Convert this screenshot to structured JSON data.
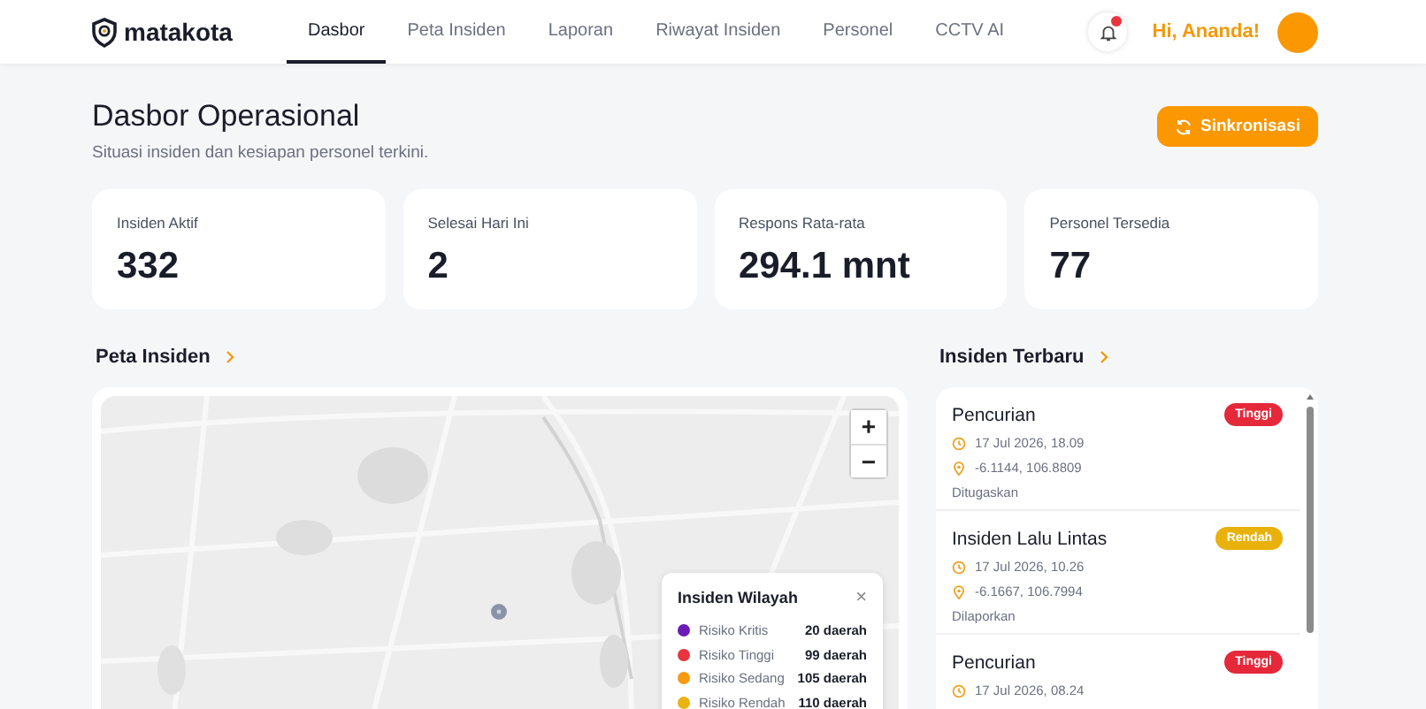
{
  "header": {
    "brand": "matakota",
    "nav": [
      {
        "label": "Dasbor",
        "selected": true
      },
      {
        "label": "Peta Insiden",
        "selected": false
      },
      {
        "label": "Laporan",
        "selected": false
      },
      {
        "label": "Riwayat Insiden",
        "selected": false
      },
      {
        "label": "Personel",
        "selected": false
      },
      {
        "label": "CCTV AI",
        "selected": false
      }
    ],
    "notification_unread": true,
    "greeting": "Hi, Ananda!"
  },
  "page": {
    "title": "Dasbor Operasional",
    "subtitle": "Situasi insiden dan kesiapan personel terkini.",
    "sync_button": "Sinkronisasi"
  },
  "stats": [
    {
      "label": "Insiden Aktif",
      "value": "332"
    },
    {
      "label": "Selesai Hari Ini",
      "value": "2"
    },
    {
      "label": "Respons Rata-rata",
      "value": "294.1 mnt"
    },
    {
      "label": "Personel Tersedia",
      "value": "77"
    }
  ],
  "map_section": {
    "title": "Peta Insiden",
    "zoom_in": "+",
    "zoom_out": "−",
    "legend": {
      "title": "Insiden Wilayah",
      "close": "×",
      "items": [
        {
          "label": "Risiko Kritis",
          "count": "20 daerah",
          "color": "#6a1bb5"
        },
        {
          "label": "Risiko Tinggi",
          "count": "99 daerah",
          "color": "#e8343f"
        },
        {
          "label": "Risiko Sedang",
          "count": "105 daerah",
          "color": "#f59a12"
        },
        {
          "label": "Risiko Rendah",
          "count": "110 daerah",
          "color": "#ebb312"
        }
      ]
    }
  },
  "recent_incidents": {
    "title": "Insiden Terbaru",
    "items": [
      {
        "title": "Pencurian",
        "badge": "Tinggi",
        "color": "#e5283a",
        "time": "17 Jul 2026, 18.09",
        "location": "-6.1144, 106.8809",
        "status": "Ditugaskan"
      },
      {
        "title": "Insiden Lalu Lintas",
        "badge": "Rendah",
        "color": "#e9b10c",
        "time": "17 Jul 2026, 10.26",
        "location": "-6.1667, 106.7994",
        "status": "Dilaporkan"
      },
      {
        "title": "Pencurian",
        "badge": "Tinggi",
        "color": "#e5283a",
        "time": "17 Jul 2026, 08.24"
      }
    ]
  }
}
